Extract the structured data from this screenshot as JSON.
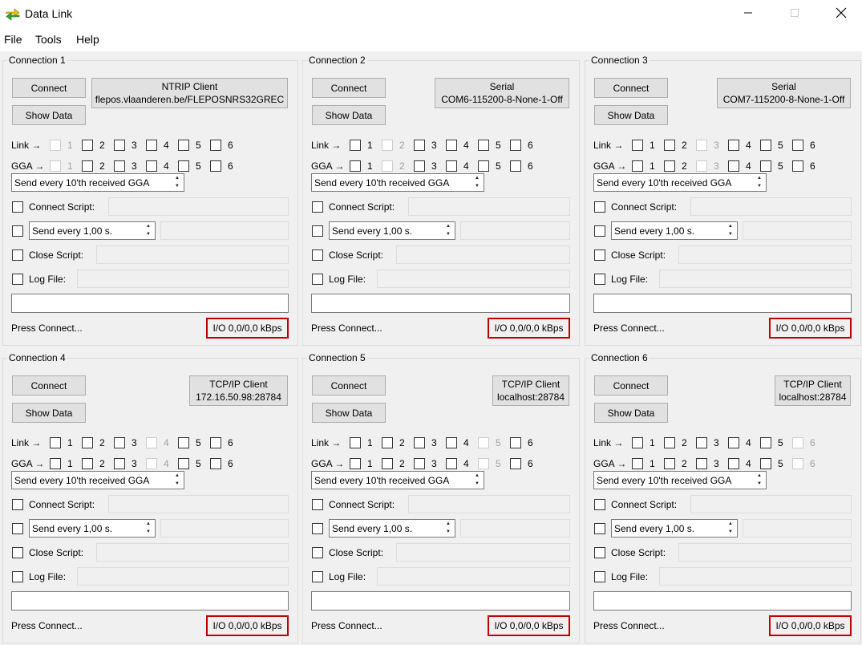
{
  "window": {
    "title": "Data Link"
  },
  "menu": [
    "File",
    "Tools",
    "Help"
  ],
  "colors": {
    "io_border": "#c00000",
    "accent_green": "#2fa82f",
    "accent_yellow": "#f2c200"
  },
  "connections": [
    {
      "title": "Connection 1",
      "connect_label": "Connect",
      "show_data_label": "Show Data",
      "source": {
        "type": "NTRIP Client",
        "detail": "flepos.vlaanderen.be/FLEPOSNRS32GREC"
      },
      "link_label": "Link →",
      "gga_label": "GGA →",
      "link_disabled": [
        1
      ],
      "gga_disabled": [
        1
      ],
      "gga_mode": "Send every 10'th received GGA",
      "connect_script_label": "Connect Script:",
      "send_every_label": "Send every 1,00 s.",
      "close_script_label": "Close Script:",
      "log_file_label": "Log File:",
      "status": "Press Connect...",
      "io": "I/O 0,0/0,0 kBps"
    },
    {
      "title": "Connection 2",
      "connect_label": "Connect",
      "show_data_label": "Show Data",
      "source": {
        "type": "Serial",
        "detail": "COM6-115200-8-None-1-Off"
      },
      "link_label": "Link →",
      "gga_label": "GGA →",
      "link_disabled": [
        2
      ],
      "gga_disabled": [
        2
      ],
      "gga_mode": "Send every 10'th received GGA",
      "connect_script_label": "Connect Script:",
      "send_every_label": "Send every 1,00 s.",
      "close_script_label": "Close Script:",
      "log_file_label": "Log File:",
      "status": "Press Connect...",
      "io": "I/O 0,0/0,0 kBps"
    },
    {
      "title": "Connection 3",
      "connect_label": "Connect",
      "show_data_label": "Show Data",
      "source": {
        "type": "Serial",
        "detail": "COM7-115200-8-None-1-Off"
      },
      "link_label": "Link →",
      "gga_label": "GGA →",
      "link_disabled": [
        3
      ],
      "gga_disabled": [
        3
      ],
      "gga_mode": "Send every 10'th received GGA",
      "connect_script_label": "Connect Script:",
      "send_every_label": "Send every 1,00 s.",
      "close_script_label": "Close Script:",
      "log_file_label": "Log File:",
      "status": "Press Connect...",
      "io": "I/O 0,0/0,0 kBps"
    },
    {
      "title": "Connection 4",
      "connect_label": "Connect",
      "show_data_label": "Show Data",
      "source": {
        "type": "TCP/IP Client",
        "detail": "172.16.50.98:28784"
      },
      "link_label": "Link →",
      "gga_label": "GGA →",
      "link_disabled": [
        4
      ],
      "gga_disabled": [
        4
      ],
      "gga_mode": "Send every 10'th received GGA",
      "connect_script_label": "Connect Script:",
      "send_every_label": "Send every 1,00 s.",
      "close_script_label": "Close Script:",
      "log_file_label": "Log File:",
      "status": "Press Connect...",
      "io": "I/O 0,0/0,0 kBps"
    },
    {
      "title": "Connection 5",
      "connect_label": "Connect",
      "show_data_label": "Show Data",
      "source": {
        "type": "TCP/IP Client",
        "detail": "localhost:28784"
      },
      "link_label": "Link →",
      "gga_label": "GGA →",
      "link_disabled": [
        5
      ],
      "gga_disabled": [
        5
      ],
      "gga_mode": "Send every 10'th received GGA",
      "connect_script_label": "Connect Script:",
      "send_every_label": "Send every 1,00 s.",
      "close_script_label": "Close Script:",
      "log_file_label": "Log File:",
      "status": "Press Connect...",
      "io": "I/O 0,0/0,0 kBps"
    },
    {
      "title": "Connection 6",
      "connect_label": "Connect",
      "show_data_label": "Show Data",
      "source": {
        "type": "TCP/IP Client",
        "detail": "localhost:28784"
      },
      "link_label": "Link →",
      "gga_label": "GGA →",
      "link_disabled": [
        6
      ],
      "gga_disabled": [
        6
      ],
      "gga_mode": "Send every 10'th received GGA",
      "connect_script_label": "Connect Script:",
      "send_every_label": "Send every 1,00 s.",
      "close_script_label": "Close Script:",
      "log_file_label": "Log File:",
      "status": "Press Connect...",
      "io": "I/O 0,0/0,0 kBps"
    }
  ],
  "checkbox_numbers": [
    "1",
    "2",
    "3",
    "4",
    "5",
    "6"
  ]
}
